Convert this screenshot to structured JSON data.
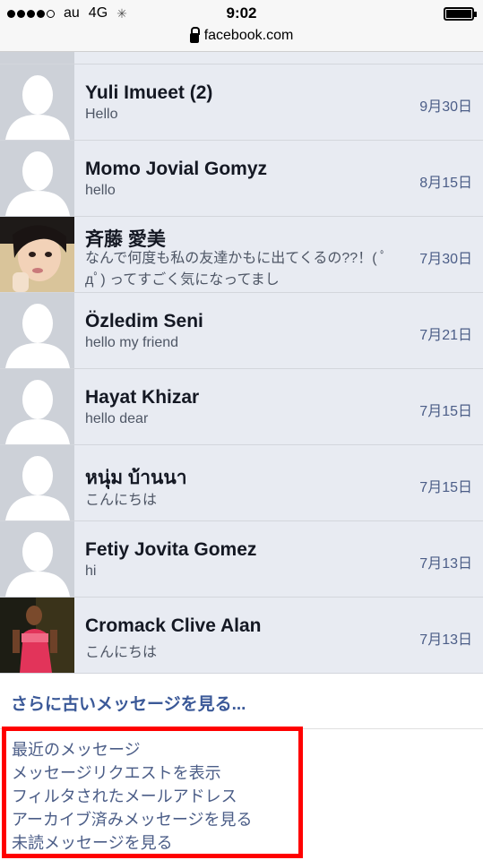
{
  "status_bar": {
    "carrier": "au",
    "network": "4G",
    "time": "9:02"
  },
  "url_bar": {
    "domain": "facebook.com"
  },
  "conversations": [
    {
      "name": "Yuli Imueet (2)",
      "snippet": "Hello",
      "date": "9月30日",
      "avatar": "default-silhouette"
    },
    {
      "name": "Momo Jovial Gomyz",
      "snippet": "hello",
      "date": "8月15日",
      "avatar": "default-silhouette"
    },
    {
      "name": "斉藤 愛美",
      "snippet": "なんで何度も私の友達かもに出てくるの??！( ﾟдﾟ) ってすごく気になってまし",
      "date": "7月30日",
      "avatar": "photo"
    },
    {
      "name": "Özledim Seni",
      "snippet": "hello my friend",
      "date": "7月21日",
      "avatar": "default-silhouette"
    },
    {
      "name": "Hayat Khizar",
      "snippet": "hello dear",
      "date": "7月15日",
      "avatar": "default-silhouette"
    },
    {
      "name": "หนุ่ม บ้านนา",
      "snippet": "こんにちは",
      "date": "7月15日",
      "avatar": "default-silhouette"
    },
    {
      "name": "Fetiy Jovita Gomez",
      "snippet": "hi",
      "date": "7月13日",
      "avatar": "default-silhouette"
    },
    {
      "name": "Cromack Clive Alan",
      "snippet": "こんにちは",
      "date": "7月13日",
      "avatar": "photo"
    }
  ],
  "see_older": "さらに古いメッセージを見る...",
  "message_links": [
    "最近のメッセージ",
    "メッセージリクエストを表示",
    "フィルタされたメールアドレス",
    "アーカイブ済みメッセージを見る",
    "未読メッセージを見る"
  ],
  "highlight_color": "#ff0000"
}
